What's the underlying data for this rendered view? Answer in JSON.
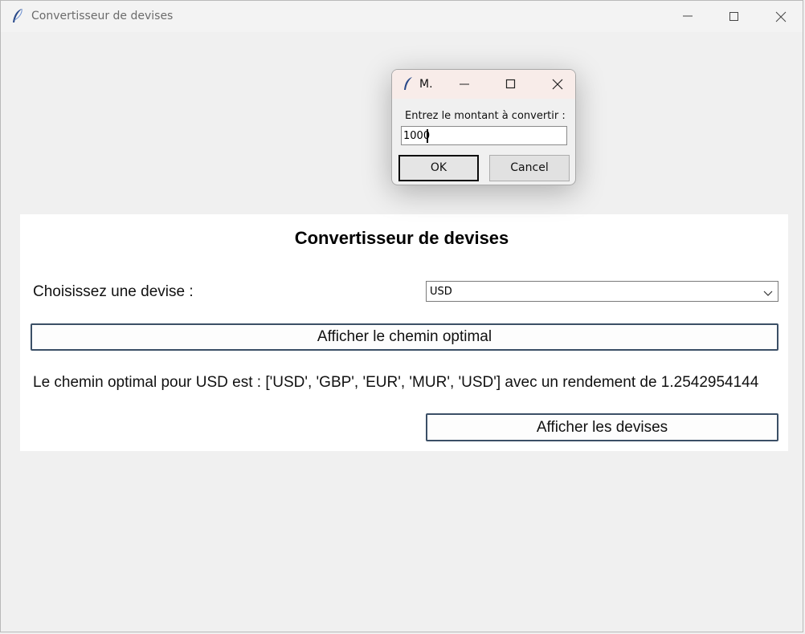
{
  "window": {
    "title": "Convertisseur de devises",
    "icon": "feather-icon"
  },
  "main": {
    "heading": "Convertisseur de devises",
    "choose_label": "Choisissez une devise :",
    "currency_select": {
      "value": "USD"
    },
    "optimal_button": "Afficher le chemin optimal",
    "result": "Le chemin optimal pour USD est : ['USD', 'GBP', 'EUR', 'MUR', 'USD'] avec un rendement de 1.2542954144",
    "currencies_button": "Afficher les devises"
  },
  "dialog": {
    "title": "M.",
    "prompt": "Entrez le montant à convertir :",
    "input_value": "1000",
    "ok_label": "OK",
    "cancel_label": "Cancel"
  },
  "colors": {
    "button_border": "#3b4f66",
    "dialog_titlebar": "#f8ece9"
  }
}
